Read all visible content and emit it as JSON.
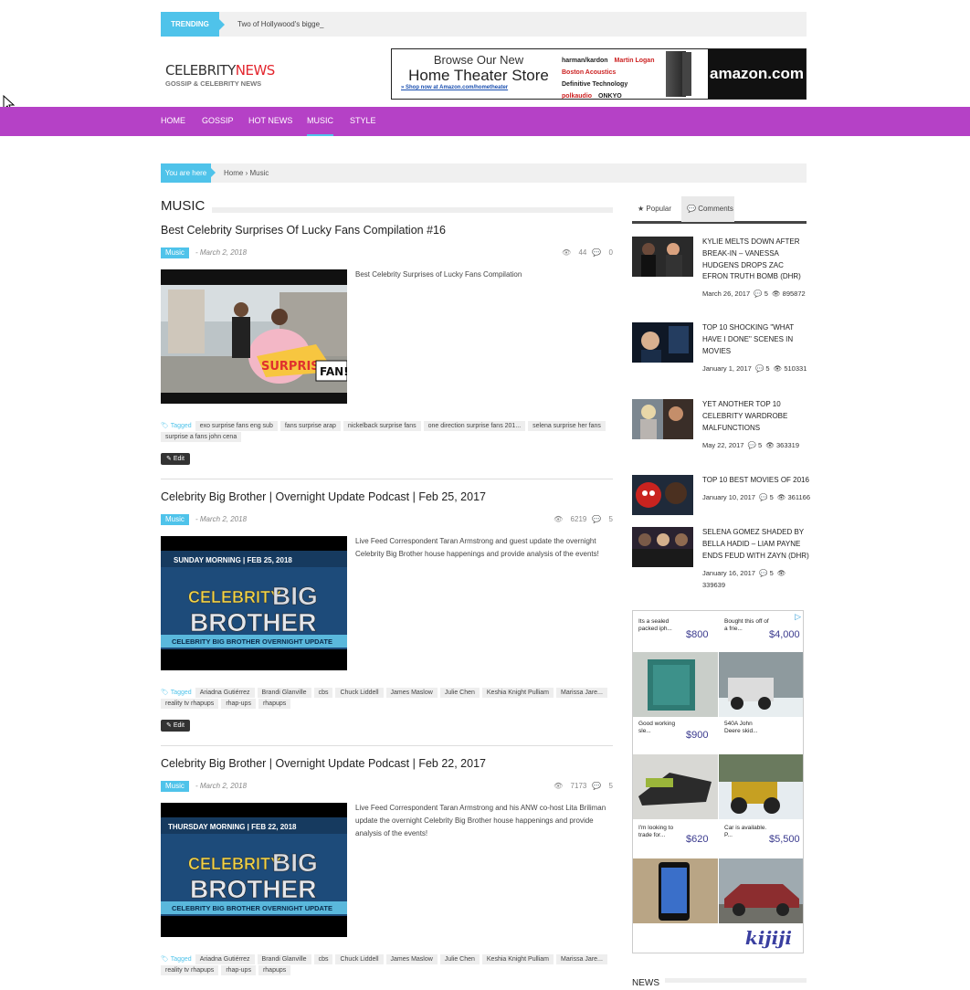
{
  "trending": {
    "label": "TRENDING",
    "text": "Two of Hollywood's bigge_"
  },
  "logo": {
    "part1": "CELEBRITY",
    "part2": "NEWS",
    "tagline": "GOSSIP & CELEBRITY NEWS"
  },
  "banner_ad": {
    "line1": "Browse Our New",
    "line2": "Home Theater Store",
    "link": "Shop now at Amazon.com/hometheater",
    "brands": [
      "harman/kardon",
      "Martin Logan",
      "Boston Acoustics",
      "Definitive Technology",
      "polkaudio",
      "ONKYO"
    ],
    "amazon": "amazon.com"
  },
  "nav": {
    "items": [
      "HOME",
      "GOSSIP",
      "HOT NEWS",
      "MUSIC",
      "STYLE"
    ],
    "active": "MUSIC"
  },
  "breadcrumb": {
    "label": "You are here",
    "path": "Home › Music"
  },
  "section": {
    "title": "MUSIC"
  },
  "posts": [
    {
      "title": "Best Celebrity Surprises Of Lucky Fans Compilation #16",
      "category": "Music",
      "date": "- March 2, 2018",
      "views": "44",
      "comments": "0",
      "excerpt": "Best Celebrity Surprises of Lucky Fans Compilation",
      "thumb_caption1": "SURPRISE!",
      "thumb_caption2": "FAN!",
      "tags_label": "Tagged",
      "tags": [
        "exo surprise fans eng sub",
        "fans surprise arap",
        "nickelback surprise fans",
        "one direction surprise fans 201...",
        "selena surprise her fans",
        "surprise a fans john cena"
      ],
      "edit": "Edit"
    },
    {
      "title": "Celebrity Big Brother | Overnight Update Podcast | Feb 25, 2017",
      "category": "Music",
      "date": "- March 2, 2018",
      "views": "6219",
      "comments": "5",
      "excerpt": "Live Feed Correspondent Taran Armstrong and guest update the overnight Celebrity Big Brother house happenings and provide analysis of the events!",
      "thumb_top": "SUNDAY MORNING | FEB 25, 2018",
      "thumb_word1": "CELEBRITY",
      "thumb_word2": "BIG",
      "thumb_word3": "BROTHER",
      "thumb_bottom": "CELEBRITY BIG BROTHER OVERNIGHT UPDATE",
      "tags_label": "Tagged",
      "tags": [
        "Ariadna Gutiérrez",
        "Brandi Glanville",
        "cbs",
        "Chuck Liddell",
        "James Maslow",
        "Julie Chen",
        "Keshia Knight Pulliam",
        "Marissa Jare...",
        "reality tv rhapups",
        "rhap-ups",
        "rhapups"
      ],
      "edit": "Edit"
    },
    {
      "title": "Celebrity Big Brother | Overnight Update Podcast | Feb 22, 2017",
      "category": "Music",
      "date": "- March 2, 2018",
      "views": "7173",
      "comments": "5",
      "excerpt": "Live Feed Correspondent Taran Armstrong and his ANW co-host Lita Briliman update the overnight Celebrity Big Brother house happenings and provide analysis of the events!",
      "thumb_top": "THURSDAY MORNING | FEB 22, 2018",
      "thumb_word1": "CELEBRITY",
      "thumb_word2": "BIG",
      "thumb_word3": "BROTHER",
      "thumb_bottom": "CELEBRITY BIG BROTHER OVERNIGHT UPDATE",
      "tags_label": "Tagged",
      "tags": [
        "Ariadna Gutiérrez",
        "Brandi Glanville",
        "cbs",
        "Chuck Liddell",
        "James Maslow",
        "Julie Chen",
        "Keshia Knight Pulliam",
        "Marissa Jare...",
        "reality tv rhapups",
        "rhap-ups",
        "rhapups"
      ]
    }
  ],
  "sidebar": {
    "tabs": [
      "Popular",
      "Comments"
    ],
    "popular": [
      {
        "title": "KYLIE MELTS DOWN AFTER BREAK-IN – VANESSA HUDGENS DROPS ZAC EFRON TRUTH BOMB (DHR)",
        "date": "March 26, 2017",
        "comments": "5",
        "views": "895872"
      },
      {
        "title": "TOP 10 SHOCKING \"WHAT HAVE I DONE\" SCENES IN MOVIES",
        "date": "January 1, 2017",
        "comments": "5",
        "views": "510331"
      },
      {
        "title": "YET ANOTHER TOP 10 CELEBRITY WARDROBE MALFUNCTIONS",
        "date": "May 22, 2017",
        "comments": "5",
        "views": "363319"
      },
      {
        "title": "TOP 10 BEST MOVIES OF 2016",
        "date": "January 10, 2017",
        "comments": "5",
        "views": "361166"
      },
      {
        "title": "SELENA GOMEZ SHADED BY BELLA HADID – LIAM PAYNE ENDS FEUD WITH ZAYN (DHR)",
        "date": "January 16, 2017",
        "comments": "5",
        "views": "339639"
      }
    ],
    "ad": {
      "items": [
        {
          "caption": "Its a sealed packed iph...",
          "price": "$800"
        },
        {
          "caption": "Bought this off of a frie...",
          "price": "$4,000"
        },
        {
          "caption": "Good working sle...",
          "price": "$900"
        },
        {
          "caption": "540A John Deere skid...",
          "price": ""
        },
        {
          "caption": "I'm looking to trade for...",
          "price": "$620"
        },
        {
          "caption": "Car is available. P...",
          "price": "$5,500"
        }
      ],
      "brand": "kijiji"
    },
    "news_title": "NEWS"
  }
}
